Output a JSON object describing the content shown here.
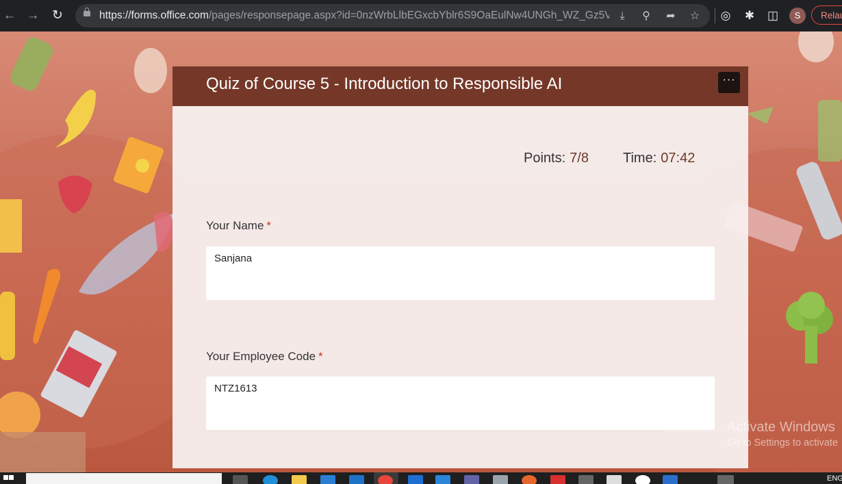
{
  "browser": {
    "url_host": "https://forms.office.com",
    "url_path": "/pages/responsepage.aspx?id=0nzWrbLlbEGxcbYblr6S9OaEulNw4UNGh_WZ_Gz5V...",
    "profile_initial": "S",
    "relaunch_label": "Relau"
  },
  "form": {
    "title": "Quiz of Course 5 - Introduction to Responsible AI",
    "more_label": "···",
    "points_label": "Points:",
    "points_value": "7/8",
    "time_label": "Time:",
    "time_value": "07:42",
    "questions": [
      {
        "label": "Your Name",
        "required": "*",
        "answer": "Sanjana"
      },
      {
        "label": "Your Employee Code",
        "required": "*",
        "answer": "NTZ1613"
      }
    ]
  },
  "watermark": {
    "line1": "Activate Windows",
    "line2": "Go to Settings to activate"
  },
  "taskbar": {
    "language": "ENG"
  },
  "colors": {
    "header": "#753828",
    "accent_required": "#c0392b",
    "chrome": "#202124"
  }
}
